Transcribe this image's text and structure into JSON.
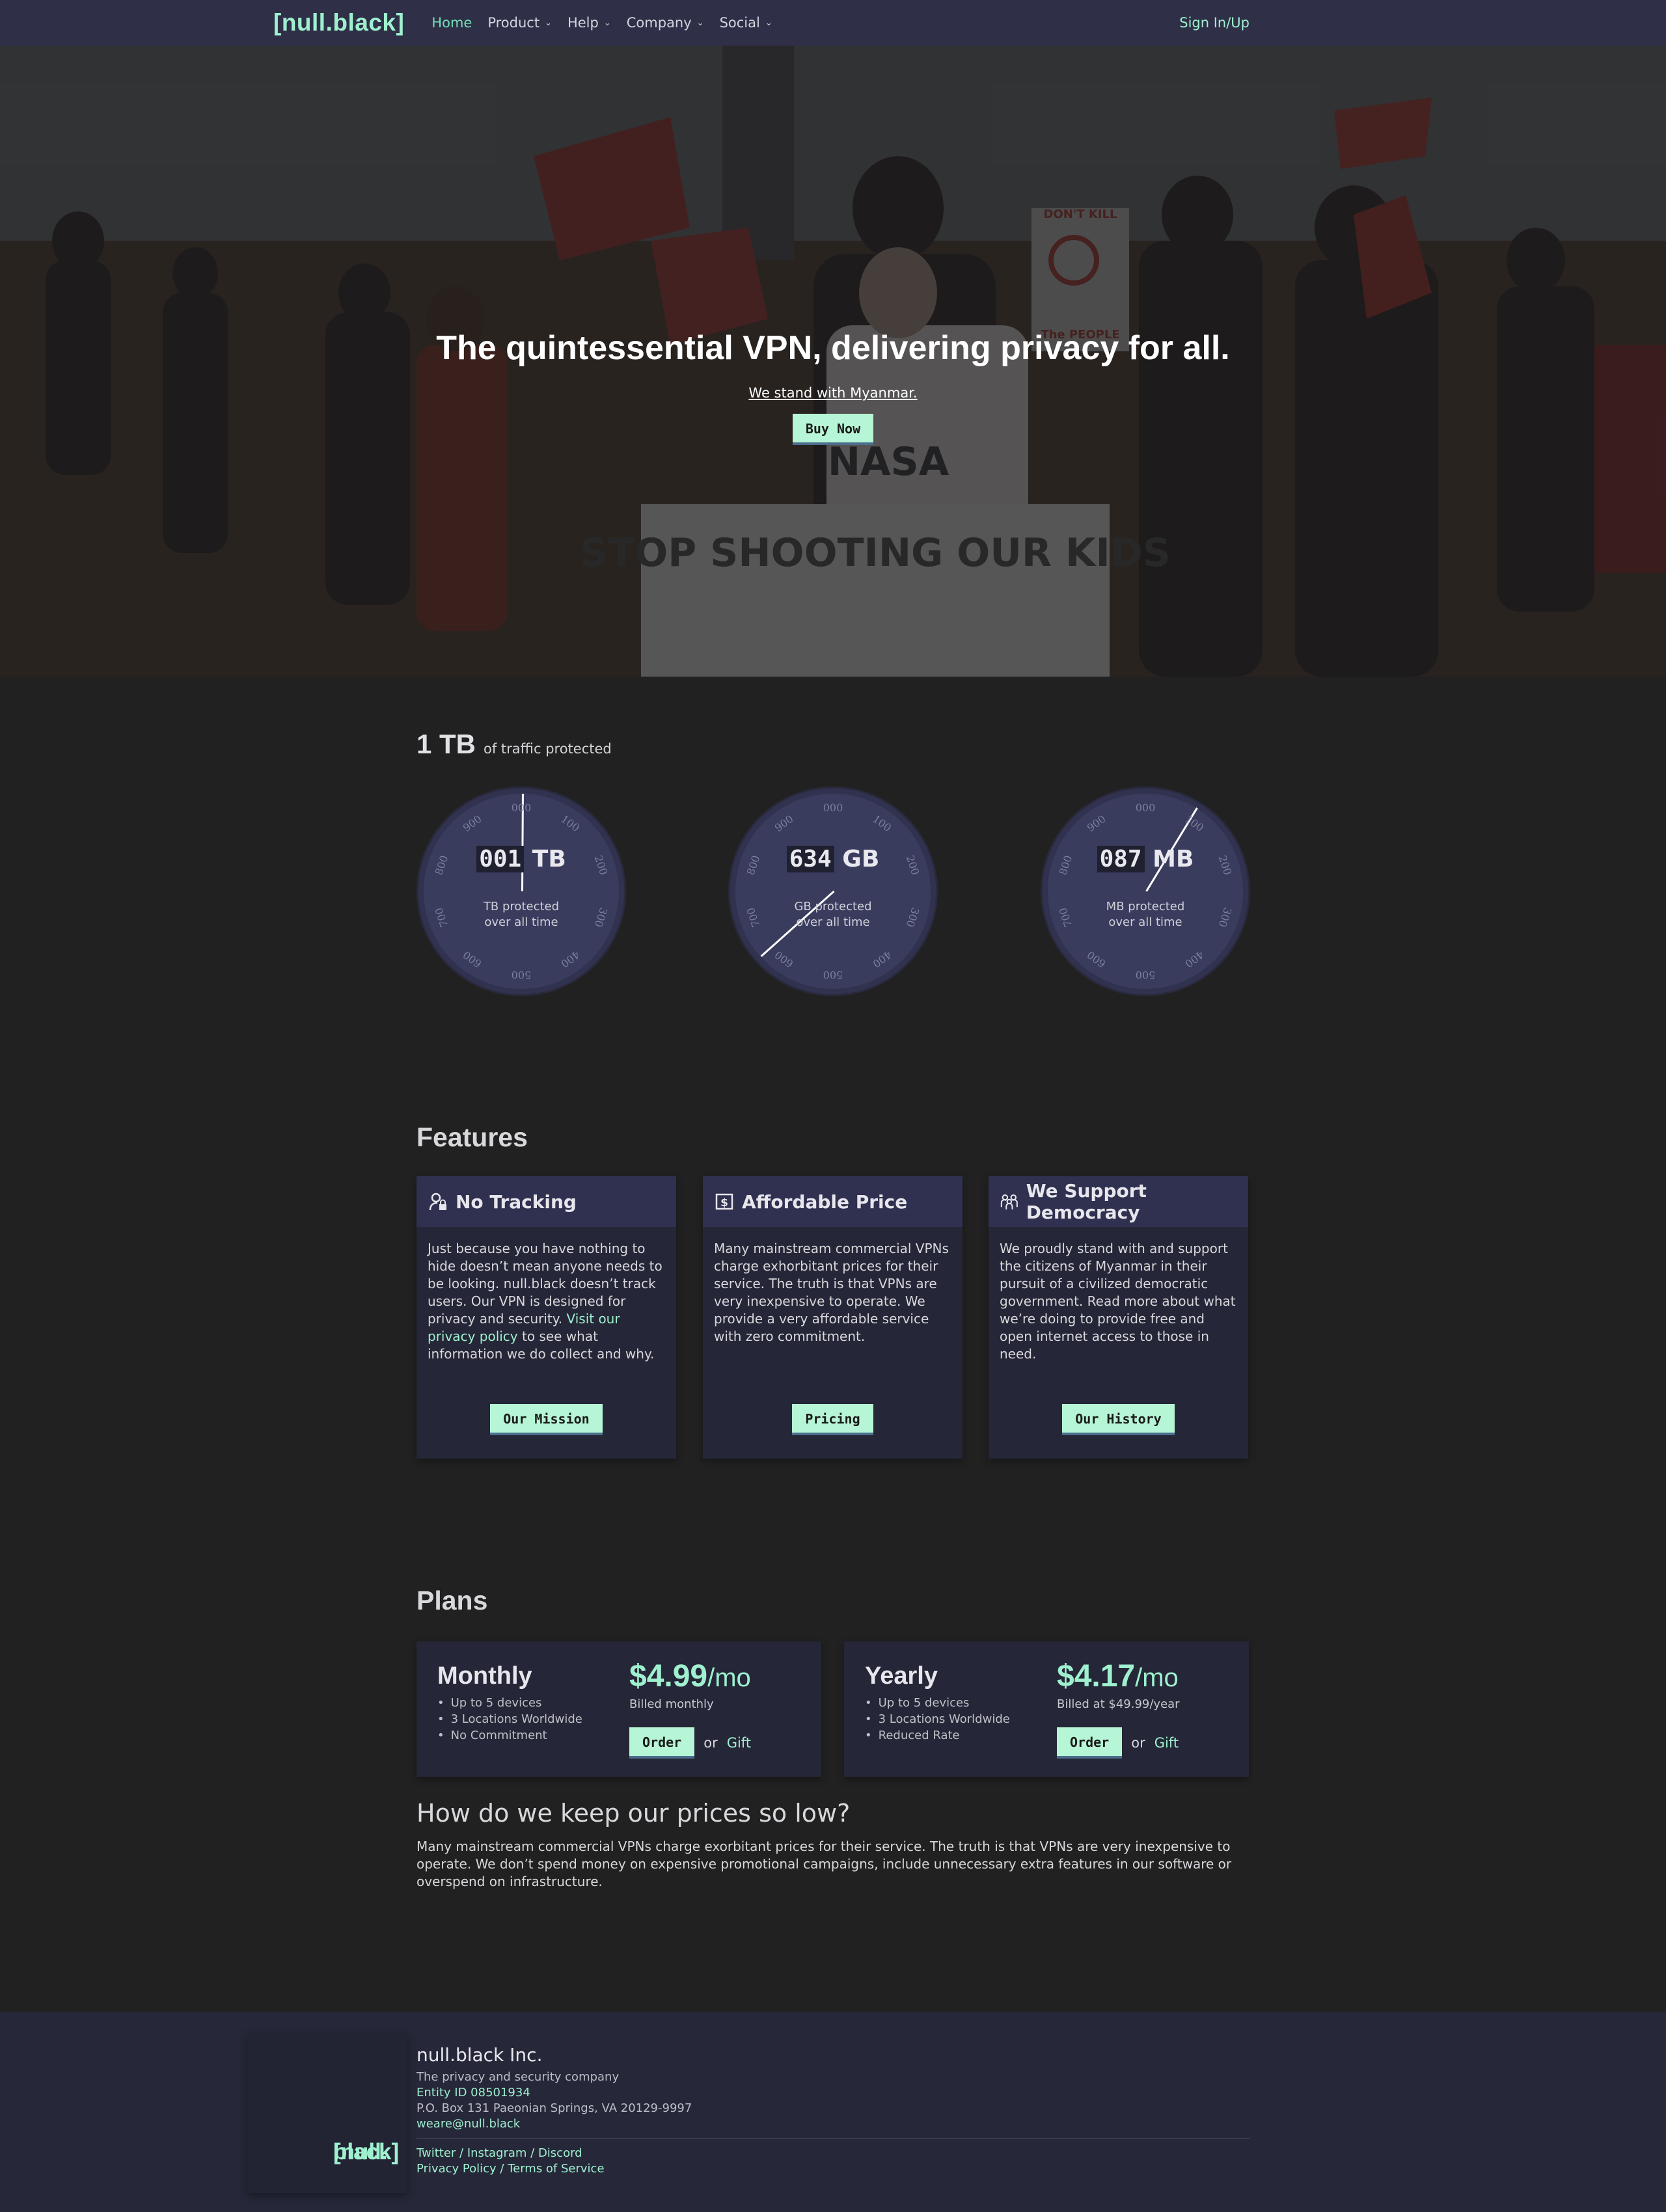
{
  "nav": {
    "logo": "[null.black]",
    "items": [
      {
        "label": "Home"
      },
      {
        "label": "Product"
      },
      {
        "label": "Help"
      },
      {
        "label": "Company"
      },
      {
        "label": "Social"
      }
    ],
    "signin": "Sign In/Up",
    "accent": "#9ff0cf"
  },
  "hero": {
    "title": "The quintessential VPN, delivering privacy for all.",
    "subtitle": "We stand with Myanmar.",
    "button": "Buy Now",
    "photo_sign_text": "STOP SHOOTING OUR KIDS",
    "photo_small_sign": "DON'T KILL",
    "photo_small_sign_bottom": "The PEOPLE",
    "photo_shirt": "NASA"
  },
  "stats": {
    "headline_value": "1 TB",
    "headline_text": "of traffic protected",
    "dial_ticks": [
      "000",
      "100",
      "200",
      "300",
      "400",
      "500",
      "600",
      "700",
      "800",
      "900"
    ],
    "dials": [
      {
        "number": "001",
        "unit": "TB",
        "caption_line1": "TB protected",
        "caption_line2": "over all time",
        "reading": 1
      },
      {
        "number": "634",
        "unit": "GB",
        "caption_line1": "GB protected",
        "caption_line2": "over all time",
        "reading": 634
      },
      {
        "number": "087",
        "unit": "MB",
        "caption_line1": "MB protected",
        "caption_line2": "over all time",
        "reading": 87
      }
    ]
  },
  "features": {
    "title": "Features",
    "cards": [
      {
        "icon": "user-lock-icon",
        "title": "No Tracking",
        "body_part1": "Just because you have nothing to hide doesn’t mean anyone needs to be looking. null.black doesn’t track users. Our VPN is designed for privacy and security.",
        "link": "Visit our privacy policy",
        "body_part2": "to see what information we do collect and why.",
        "button": "Our Mission"
      },
      {
        "icon": "dollar-icon",
        "title": "Affordable Price",
        "body": "Many mainstream commercial VPNs charge exhorbitant prices for their service. The truth is that VPNs are very inexpensive to operate. We provide a very affordable service with zero commitment.",
        "button": "Pricing"
      },
      {
        "icon": "people-icon",
        "title": "We Support Democracy",
        "body": "We proudly stand with and support the citizens of Myanmar in their pursuit of a civilized democratic government. Read more about what we’re doing to provide free and open internet access to those in need.",
        "button": "Our History"
      }
    ]
  },
  "plans": {
    "title": "Plans",
    "items": [
      {
        "name": "Monthly",
        "features": [
          "Up to 5 devices",
          "3 Locations Worldwide",
          "No Commitment"
        ],
        "price": "$4.99",
        "per": "/mo",
        "billed": "Billed monthly",
        "order": "Order",
        "or": "or",
        "gift": "Gift"
      },
      {
        "name": "Yearly",
        "features": [
          "Up to 5 devices",
          "3 Locations Worldwide",
          "Reduced Rate"
        ],
        "price": "$4.17",
        "per": "/mo",
        "billed": "Billed at $49.99/year",
        "order": "Order",
        "or": "or",
        "gift": "Gift"
      }
    ]
  },
  "faq": {
    "title": "How do we keep our prices so low?",
    "body": "Many mainstream commercial VPNs charge exorbitant prices for their service. The truth is that VPNs are very inexpensive to operate. We don’t spend money on expensive promotional campaigns, include unnecessary extra features in our software or overspend on infrastructure."
  },
  "footer": {
    "logo_line1": "[null.",
    "logo_line2": "black]",
    "company": "null.black Inc.",
    "tagline": "The privacy and security company",
    "entity": "Entity ID 08501934",
    "address": "P.O. Box 131 Paeonian Springs, VA 20129-9997",
    "email": "weare@null.black",
    "links1": [
      "Twitter",
      "Instagram",
      "Discord"
    ],
    "links2": [
      "Privacy Policy",
      "Terms of Service"
    ],
    "separator": " / "
  }
}
